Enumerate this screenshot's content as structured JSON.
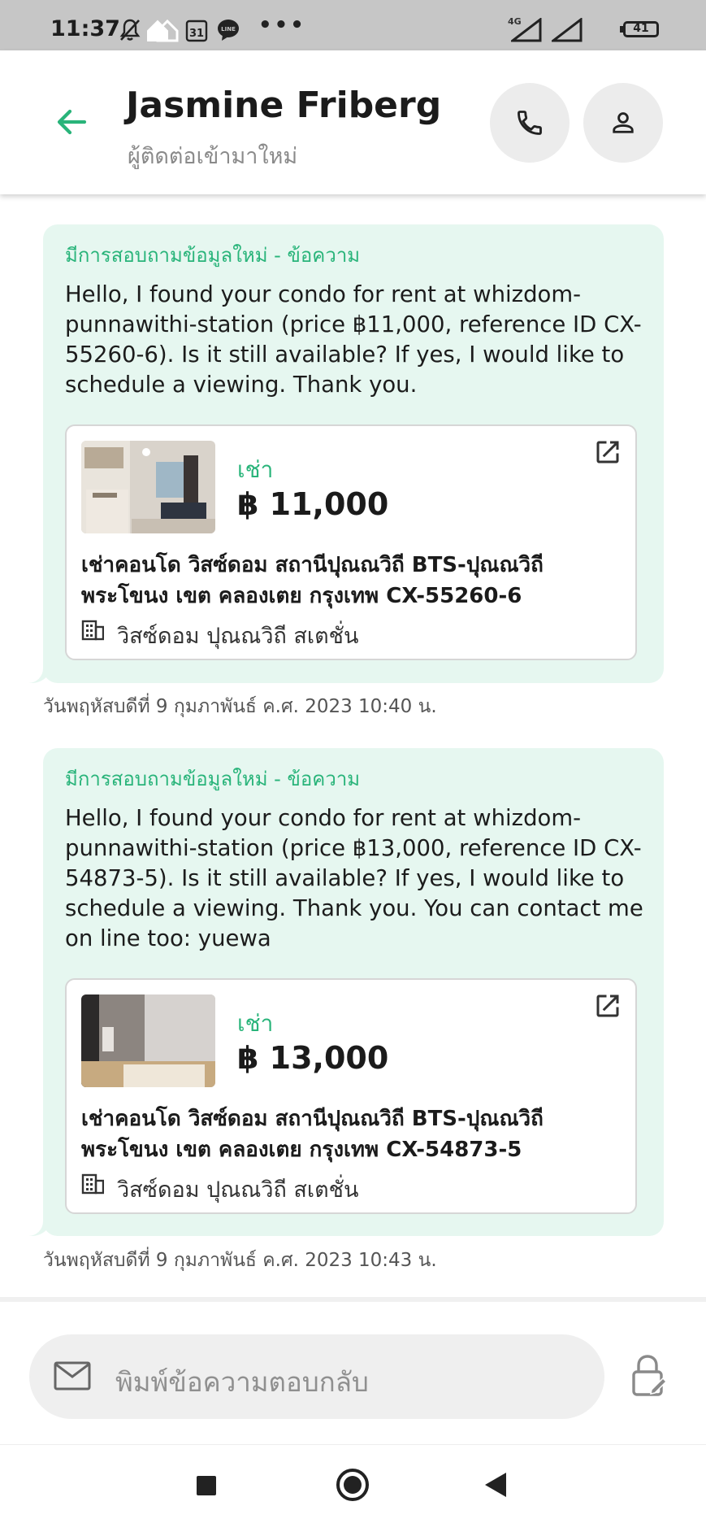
{
  "status_bar": {
    "time": "11:37",
    "network": "4G",
    "battery_level": "41",
    "icons": [
      "mute-icon",
      "home-icon",
      "calendar-31-icon",
      "line-icon",
      "more-icon",
      "signal-icon",
      "battery-icon"
    ],
    "calendar_day": "31",
    "line_label": "LINE"
  },
  "header": {
    "name": "Jasmine Friberg",
    "subtitle": "ผู้ติดต่อเข้ามาใหม่",
    "accent_color": "#29b47a"
  },
  "messages": [
    {
      "header": "มีการสอบถามข้อมูลใหม่ - ข้อความ",
      "text": "Hello, I found your condo for rent at whizdom-punnawithi-station (price ฿11,000, reference ID CX-55260-6). Is it still available? If yes, I would like to schedule a viewing. Thank you.",
      "listing": {
        "type": "เช่า",
        "price": "฿ 11,000",
        "title": "เช่าคอนโด  วิสซ์ดอม สถานีปุณณวิถี BTS-ปุณณวิถี พระโขนง เขต คลองเตย กรุงเทพ CX-55260-6",
        "project": "วิสซ์ดอม ปุณณวิถี สเตชั่น"
      },
      "timestamp": "วันพฤหัสบดีที่ 9 กุมภาพันธ์ ค.ศ. 2023 10:40 น."
    },
    {
      "header": "มีการสอบถามข้อมูลใหม่ - ข้อความ",
      "text": "Hello, I found your condo for rent at whizdom-punnawithi-station (price ฿13,000, reference ID CX-54873-5). Is it still available? If yes, I would like to schedule a viewing. Thank you. You can contact me on line too: yuewa",
      "listing": {
        "type": "เช่า",
        "price": "฿ 13,000",
        "title": "เช่าคอนโด  วิสซ์ดอม สถานีปุณณวิถี BTS-ปุณณวิถี พระโขนง เขต คลองเตย กรุงเทพ CX-54873-5",
        "project": "วิสซ์ดอม ปุณณวิถี สเตชั่น"
      },
      "timestamp": "วันพฤหัสบดีที่ 9 กุมภาพันธ์ ค.ศ. 2023 10:43 น."
    }
  ],
  "reply": {
    "placeholder": "พิมพ์ข้อความตอบกลับ"
  },
  "colors": {
    "bubble_bg": "#e6f7f0",
    "accent": "#29b47a",
    "status_bar": "#c6c6c6"
  }
}
